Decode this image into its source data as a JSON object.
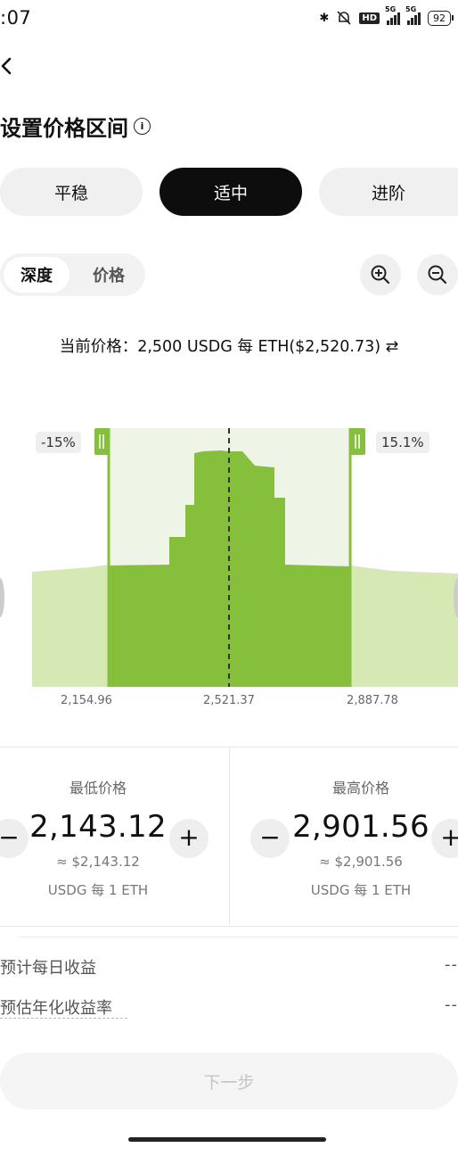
{
  "status": {
    "time": ":07",
    "network": "5G",
    "hd": "HD",
    "battery": "92"
  },
  "page": {
    "title": "设置价格区间"
  },
  "segments": [
    {
      "label": "平稳",
      "active": false
    },
    {
      "label": "适中",
      "active": true
    },
    {
      "label": "进阶",
      "active": false
    }
  ],
  "view_toggle": {
    "options": [
      "深度",
      "价格"
    ],
    "selected": "深度"
  },
  "current_price": "当前价格：2,500 USDG 每 ETH($2,520.73) ⇄",
  "chart": {
    "left_pct": "-15%",
    "right_pct": "15.1%",
    "ticks": [
      "2,154.96",
      "2,521.37",
      "2,887.78"
    ]
  },
  "chart_data": {
    "type": "area",
    "title": "",
    "xlabel": "",
    "ylabel": "",
    "x": [
      2154.96,
      2521.37,
      2887.78
    ],
    "selected_range": [
      2143.12,
      2901.56
    ],
    "current_price": 2521.37
  },
  "min_card": {
    "label": "最低价格",
    "value": "2,143.12",
    "usd": "≈ $2,143.12",
    "unit": "USDG 每 1 ETH"
  },
  "max_card": {
    "label": "最高价格",
    "value": "2,901.56",
    "usd": "≈ $2,901.56",
    "unit": "USDG 每 1 ETH"
  },
  "stats": [
    {
      "label": "预计每日收益",
      "value": "--"
    },
    {
      "label": "预估年化收益率",
      "value": "--"
    }
  ],
  "next_button": "下一步",
  "colors": {
    "accent": "#8dc63f",
    "dark": "#0d0d0d",
    "range_bg": "#eef5e6"
  }
}
